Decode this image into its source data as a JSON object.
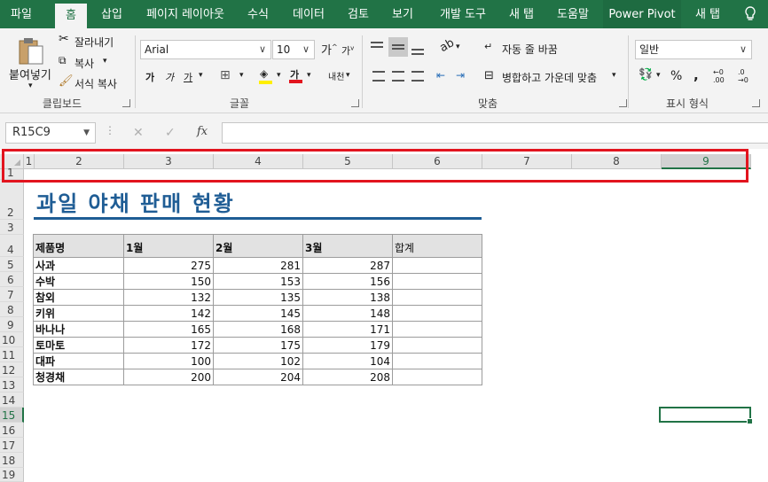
{
  "tabs": [
    "파일",
    "홈",
    "삽입",
    "페이지 레이아웃",
    "수식",
    "데이터",
    "검토",
    "보기",
    "개발 도구",
    "새 탭",
    "도움말",
    "Power Pivot",
    "새 탭"
  ],
  "ribbon": {
    "clipboard": {
      "paste": "붙여넣기",
      "cut": "잘라내기",
      "copy": "복사",
      "format_painter": "서식 복사",
      "label": "클립보드"
    },
    "font": {
      "name": "Arial",
      "size": "10",
      "grow": "가",
      "shrink": "가",
      "bold": "가",
      "italic": "가",
      "underline": "가",
      "font_color": "가",
      "phonetic": "내천",
      "label": "글꼴"
    },
    "align": {
      "wrap": "자동 줄 바꿈",
      "merge": "병합하고 가운데 맞춤",
      "label": "맞춤"
    },
    "number": {
      "format": "일반",
      "percent": "%",
      "comma": ",",
      "inc_decimal": ".00",
      "dec_decimal": ".0",
      "label": "표시 형식"
    }
  },
  "formula_bar": {
    "name_box": "R15C9",
    "cancel": "✕",
    "enter": "✓",
    "fx": "fx",
    "value": ""
  },
  "columns": [
    "1",
    "2",
    "3",
    "4",
    "5",
    "6",
    "7",
    "8",
    "9"
  ],
  "rows": [
    "1",
    "2",
    "3",
    "4",
    "5",
    "6",
    "7",
    "8",
    "9",
    "10",
    "11",
    "12",
    "13",
    "14",
    "15",
    "16",
    "17",
    "18",
    "19"
  ],
  "sheet": {
    "title": "과일 야채 판매 현황",
    "headers": [
      "제품명",
      "1월",
      "2월",
      "3월",
      "합계"
    ],
    "data": [
      [
        "사과",
        "275",
        "281",
        "287",
        ""
      ],
      [
        "수박",
        "150",
        "153",
        "156",
        ""
      ],
      [
        "참외",
        "132",
        "135",
        "138",
        ""
      ],
      [
        "키위",
        "142",
        "145",
        "148",
        ""
      ],
      [
        "바나나",
        "165",
        "168",
        "171",
        ""
      ],
      [
        "토마토",
        "172",
        "175",
        "179",
        ""
      ],
      [
        "대파",
        "100",
        "102",
        "104",
        ""
      ],
      [
        "청경채",
        "200",
        "204",
        "208",
        ""
      ]
    ]
  },
  "selection": {
    "row": "15",
    "column": "9"
  },
  "colors": {
    "excel_green": "#217346",
    "title_blue": "#1f5d95",
    "highlight_red": "#e2141e"
  }
}
